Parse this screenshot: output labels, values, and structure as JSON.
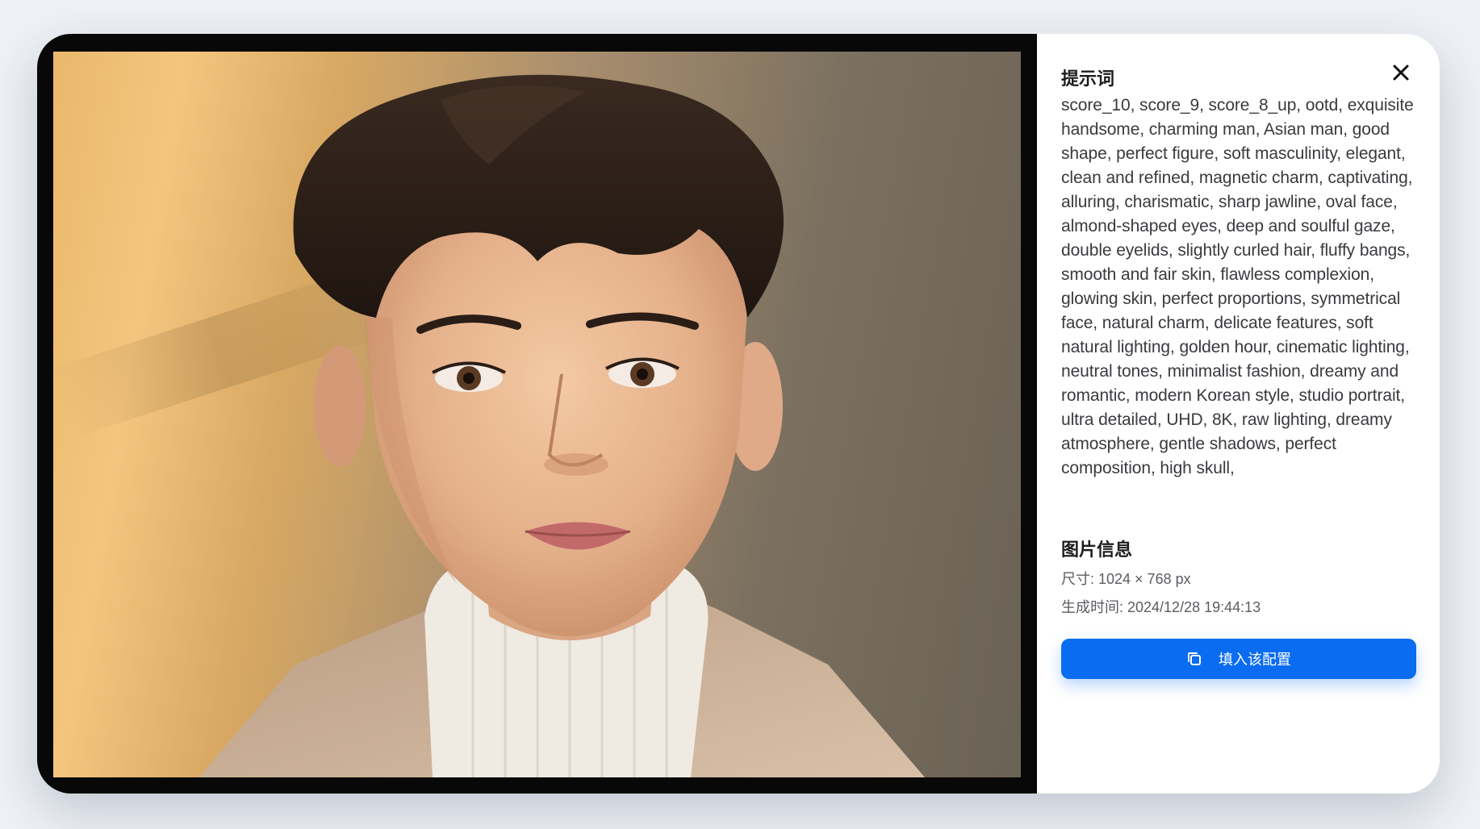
{
  "prompt_section": {
    "title": "提示词",
    "text": "score_10, score_9, score_8_up, ootd, exquisite handsome, charming man, Asian man, good shape, perfect figure, soft masculinity, elegant, clean and refined, magnetic charm, captivating, alluring, charismatic, sharp jawline, oval face, almond-shaped eyes, deep and soulful gaze, double eyelids, slightly curled hair, fluffy bangs, smooth and fair skin, flawless complexion, glowing skin, perfect proportions, symmetrical face, natural charm, delicate features, soft natural lighting, golden hour, cinematic lighting, neutral tones, minimalist fashion, dreamy and romantic, modern Korean style, studio portrait, ultra detailed, UHD, 8K, raw lighting, dreamy atmosphere, gentle shadows, perfect composition, high skull,"
  },
  "image_info": {
    "title": "图片信息",
    "size_line": "尺寸: 1024 × 768 px",
    "time_line": "生成时间: 2024/12/28 19:44:13"
  },
  "actions": {
    "fill_label": "填入该配置"
  },
  "icons": {
    "close": "close-icon",
    "copy": "copy-icon"
  },
  "colors": {
    "accent": "#0a6cf0",
    "image_frame": "#080808",
    "page_background": "#eef1f5"
  }
}
